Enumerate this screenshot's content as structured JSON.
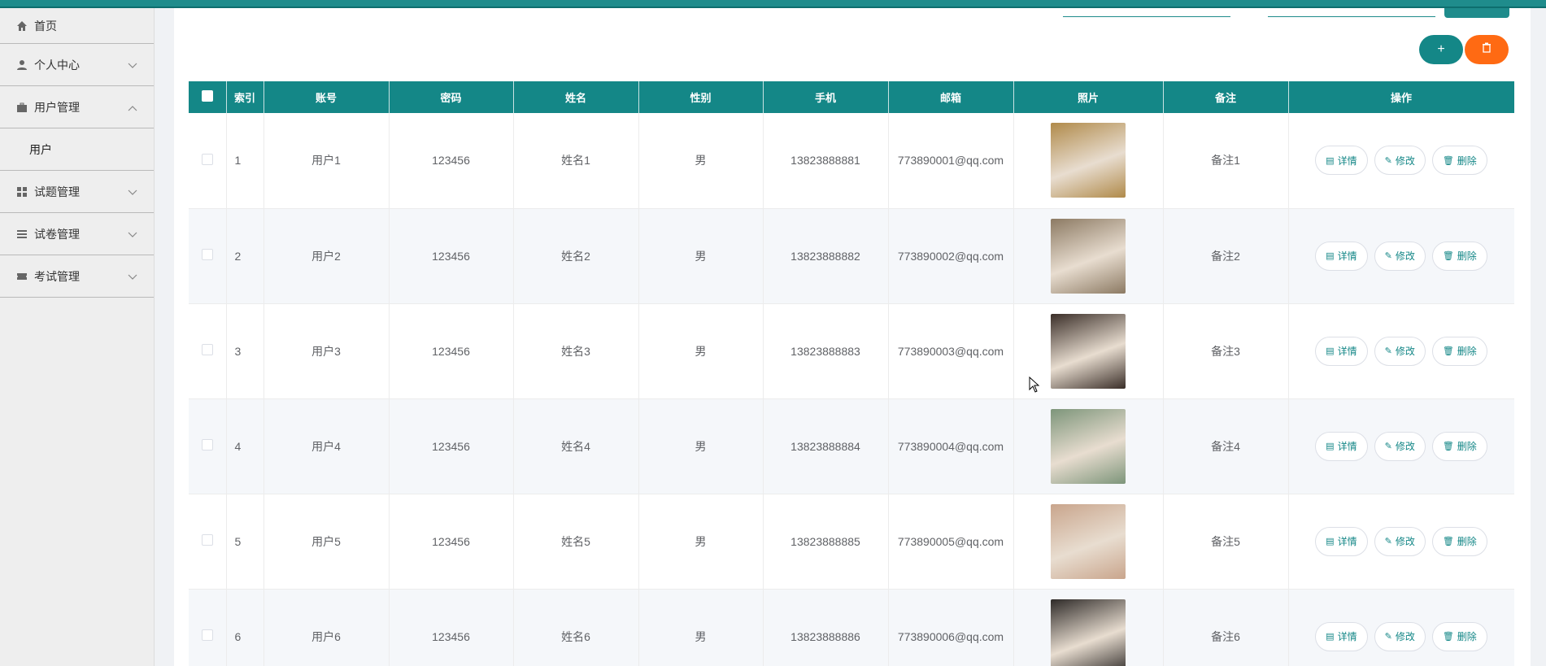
{
  "sidebar": {
    "items": [
      {
        "label": "首页",
        "icon": "home-icon",
        "expandable": false
      },
      {
        "label": "个人中心",
        "icon": "user-icon",
        "expandable": true,
        "expanded": false
      },
      {
        "label": "用户管理",
        "icon": "briefcase-icon",
        "expandable": true,
        "expanded": true,
        "children": [
          {
            "label": "用户"
          }
        ]
      },
      {
        "label": "试题管理",
        "icon": "grid-icon",
        "expandable": true,
        "expanded": false
      },
      {
        "label": "试卷管理",
        "icon": "list-icon",
        "expandable": true,
        "expanded": false
      },
      {
        "label": "考试管理",
        "icon": "ticket-icon",
        "expandable": true,
        "expanded": false
      }
    ]
  },
  "toolbar": {
    "add_label": "+",
    "delete_icon": "trash-icon"
  },
  "table": {
    "columns": [
      "",
      "索引",
      "账号",
      "密码",
      "姓名",
      "性别",
      "手机",
      "邮箱",
      "照片",
      "备注",
      "操作"
    ],
    "rows": [
      {
        "index": "1",
        "account": "用户1",
        "password": "123456",
        "name": "姓名1",
        "gender": "男",
        "phone": "13823888881",
        "email": "773890001@qq.com",
        "note": "备注1",
        "photo": "#b08a4a"
      },
      {
        "index": "2",
        "account": "用户2",
        "password": "123456",
        "name": "姓名2",
        "gender": "男",
        "phone": "13823888882",
        "email": "773890002@qq.com",
        "note": "备注2",
        "photo": "#8c7a63"
      },
      {
        "index": "3",
        "account": "用户3",
        "password": "123456",
        "name": "姓名3",
        "gender": "男",
        "phone": "13823888883",
        "email": "773890003@qq.com",
        "note": "备注3",
        "photo": "#3a2e28"
      },
      {
        "index": "4",
        "account": "用户4",
        "password": "123456",
        "name": "姓名4",
        "gender": "男",
        "phone": "13823888884",
        "email": "773890004@qq.com",
        "note": "备注4",
        "photo": "#7d957a"
      },
      {
        "index": "5",
        "account": "用户5",
        "password": "123456",
        "name": "姓名5",
        "gender": "男",
        "phone": "13823888885",
        "email": "773890005@qq.com",
        "note": "备注5",
        "photo": "#c9a58c"
      },
      {
        "index": "6",
        "account": "用户6",
        "password": "123456",
        "name": "姓名6",
        "gender": "男",
        "phone": "13823888886",
        "email": "773890006@qq.com",
        "note": "备注6",
        "photo": "#2e2a28"
      }
    ],
    "actions": {
      "detail": "详情",
      "edit": "修改",
      "delete": "删除"
    }
  },
  "colors": {
    "accent": "#148787",
    "danger": "#ff6a13"
  }
}
